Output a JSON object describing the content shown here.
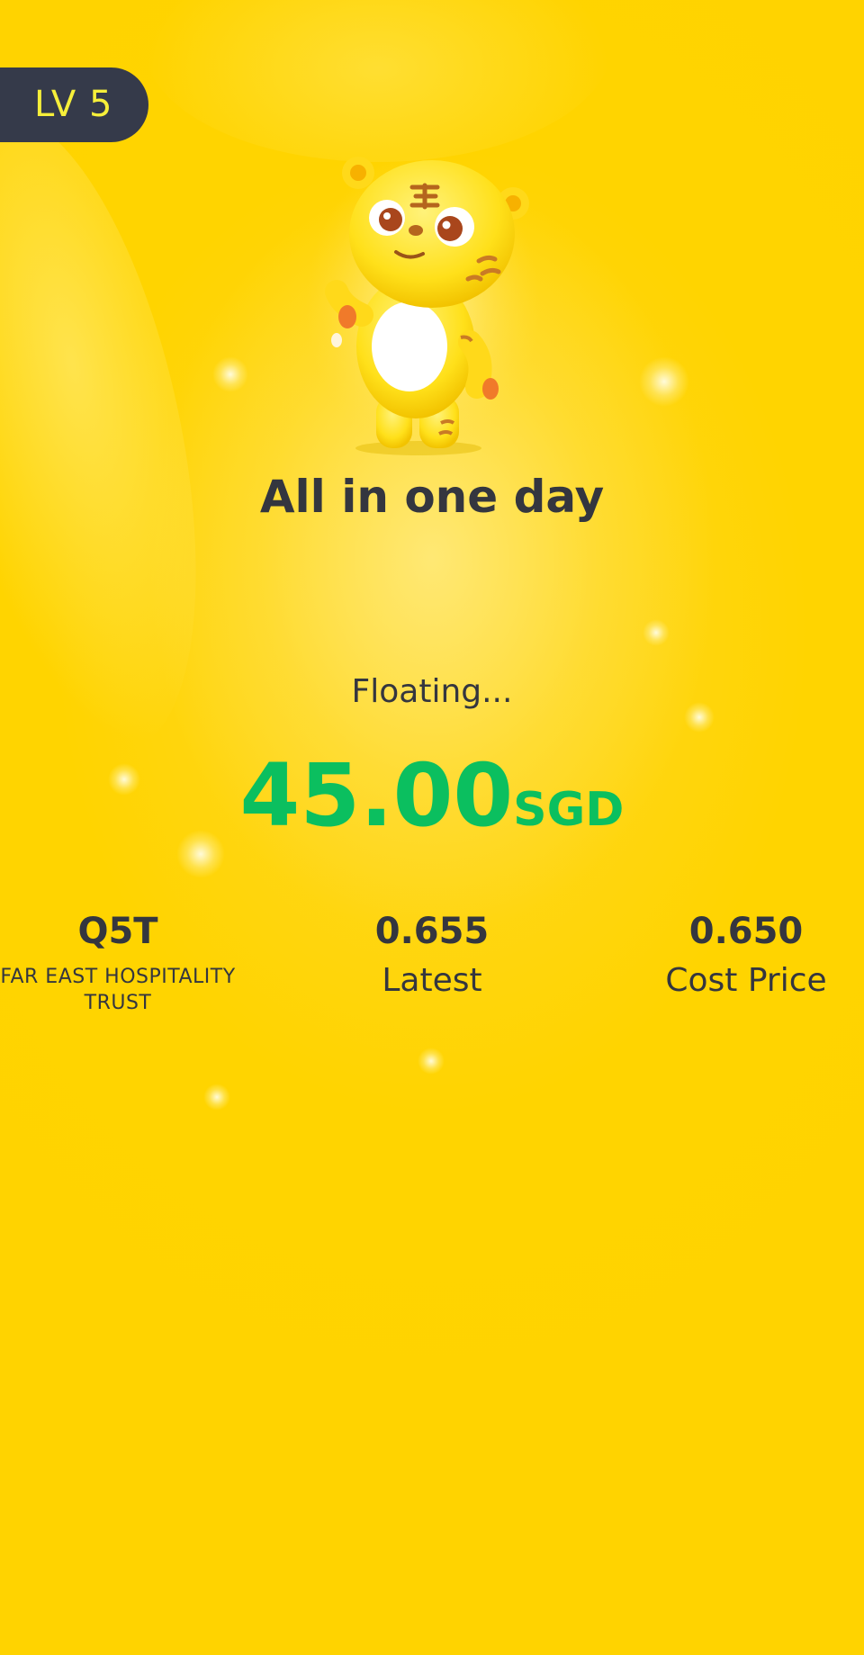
{
  "level_badge": {
    "text": "LV 5"
  },
  "headline": "All in one day",
  "status": "Floating...",
  "profit": {
    "value": "45.00",
    "currency": "SGD"
  },
  "stock": {
    "symbol": "Q5T",
    "name_line1": "FAR EAST HOSPITALITY",
    "name_line2": "TRUST",
    "latest_price": "0.655",
    "latest_label": "Latest",
    "cost_price": "0.650",
    "cost_label": "Cost Price"
  },
  "colors": {
    "background": "#ffd400",
    "badge_background": "#353a4a",
    "badge_text": "#f6ef3a",
    "profit": "#0bbf5f",
    "text": "#34363f"
  },
  "icons": {
    "mascot": "tiger-mascot-icon"
  }
}
